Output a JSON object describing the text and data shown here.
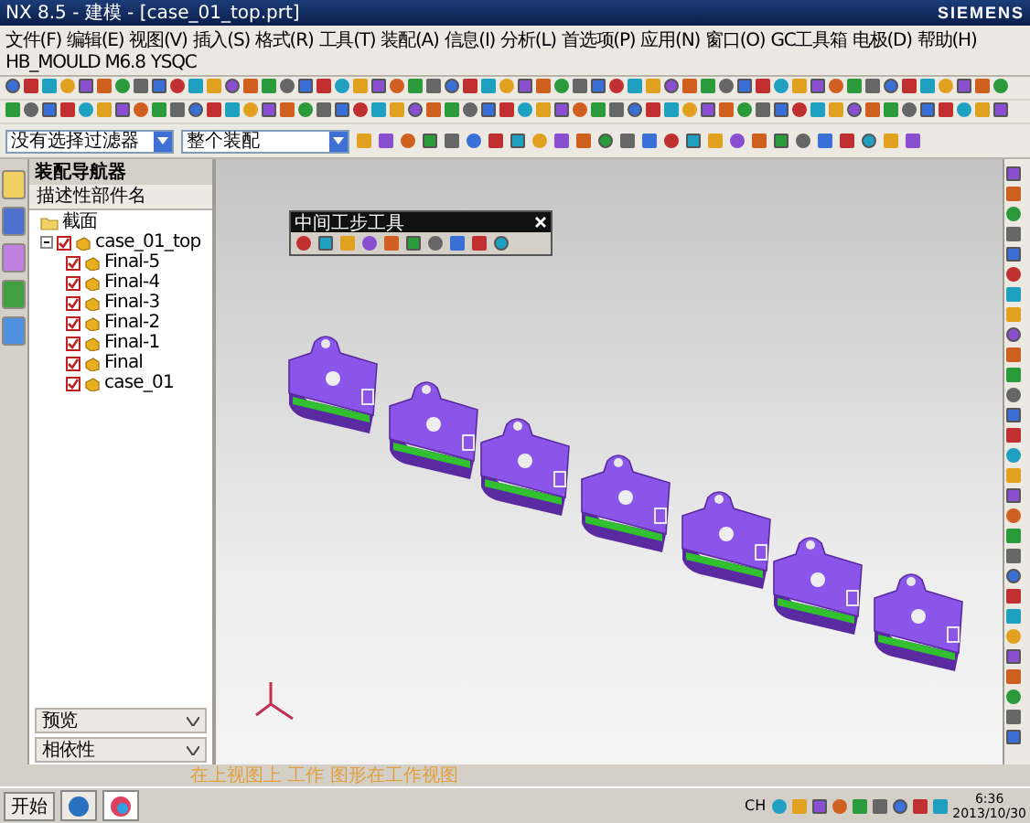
{
  "window": {
    "title": "NX 8.5 - 建模 - [case_01_top.prt]",
    "brand": "SIEMENS"
  },
  "menu": [
    "文件(F)",
    "编辑(E)",
    "视图(V)",
    "插入(S)",
    "格式(R)",
    "工具(T)",
    "装配(A)",
    "信息(I)",
    "分析(L)",
    "首选项(P)",
    "应用(N)",
    "窗口(O)",
    "GC工具箱",
    "电极(D)",
    "帮助(H)",
    "HB_MOULD M6.8",
    "YSQC"
  ],
  "filter_bar": {
    "type_filter": "没有选择过滤器",
    "scope": "整个装配"
  },
  "navigator": {
    "title": "装配导航器",
    "column": "描述性部件名",
    "tree": [
      {
        "label": "截面",
        "kind": "folder"
      },
      {
        "label": "case_01_top",
        "kind": "assembly",
        "checked": true,
        "expanded": true,
        "children": [
          {
            "label": "Final-5",
            "kind": "part",
            "checked": true
          },
          {
            "label": "Final-4",
            "kind": "part",
            "checked": true
          },
          {
            "label": "Final-3",
            "kind": "part",
            "checked": true
          },
          {
            "label": "Final-2",
            "kind": "part",
            "checked": true
          },
          {
            "label": "Final-1",
            "kind": "part",
            "checked": true
          },
          {
            "label": "Final",
            "kind": "part",
            "checked": true
          },
          {
            "label": "case_01",
            "kind": "part",
            "checked": true
          }
        ]
      }
    ],
    "sections": [
      {
        "label": "预览",
        "expanded": false
      },
      {
        "label": "相依性",
        "expanded": false
      }
    ]
  },
  "floating_toolbar": {
    "title": "中间工步工具"
  },
  "status_bar": {
    "message": "在上视图上 工作 图形在工作视图"
  },
  "taskbar": {
    "start": "开始",
    "language": "CH",
    "time": "6:36",
    "date": "2013/10/30"
  }
}
